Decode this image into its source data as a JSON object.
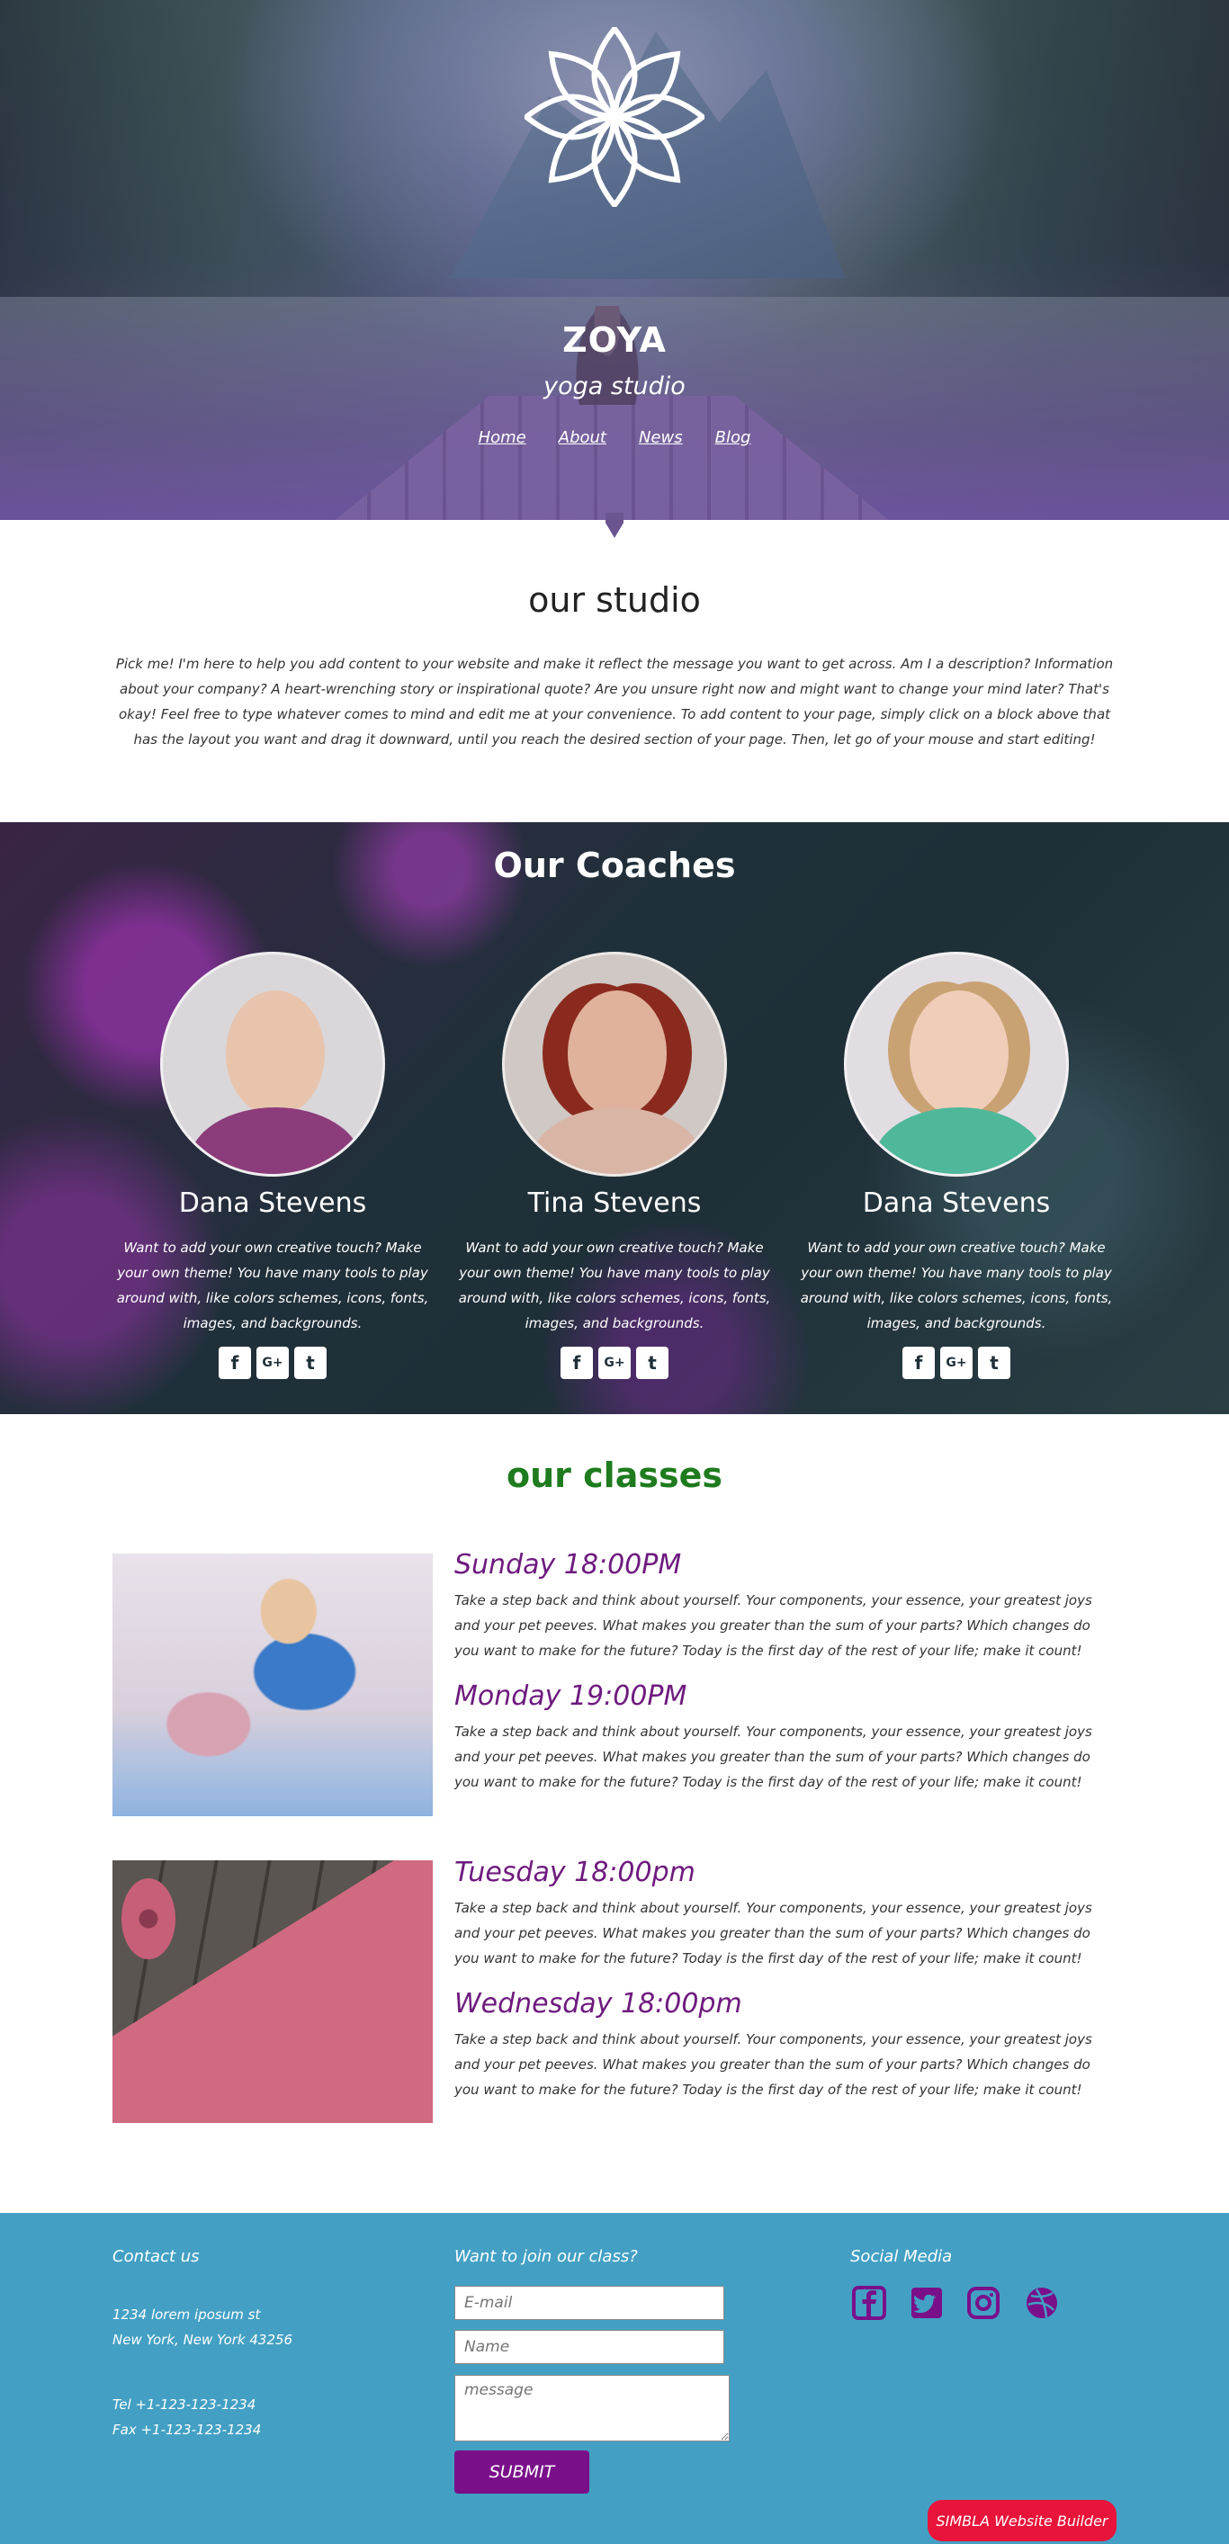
{
  "brand": {
    "title": "ZOYA",
    "subtitle": "yoga studio"
  },
  "nav": [
    {
      "label": "Home"
    },
    {
      "label": "About"
    },
    {
      "label": "News"
    },
    {
      "label": "Blog"
    }
  ],
  "studio": {
    "title": "our studio",
    "text": "Pick me! I'm here to help you add content to your website and make it reflect the message you want to get across. Am I a description? Information about your company? A heart-wrenching story or inspirational quote? Are you unsure right now and might want to change your mind later? That's okay! Feel free to type whatever comes to mind and edit me at your convenience. To add content to your page, simply click on a block above that has the layout you want and drag it downward, until you reach the desired section of your page. Then, let go of your mouse and start editing!"
  },
  "coaches": {
    "title": "Our Coaches",
    "items": [
      {
        "name": "Dana Stevens",
        "bio": "Want to add your own creative touch? Make your own theme! You have many tools to play around with, like colors schemes, icons, fonts, images, and backgrounds."
      },
      {
        "name": "Tina Stevens",
        "bio": "Want to add your own creative touch? Make your own theme! You have many tools to play around with, like colors schemes, icons, fonts, images, and backgrounds."
      },
      {
        "name": "Dana Stevens",
        "bio": "Want to add your own creative touch? Make your own theme! You have many tools to play around with, like colors schemes, icons, fonts, images, and backgrounds."
      }
    ],
    "social_icons": [
      "facebook-icon",
      "google-plus-icon",
      "twitter-icon"
    ]
  },
  "classes": {
    "title": "our classes",
    "items": [
      {
        "time": "Sunday 18:00PM",
        "desc": "Take a step back and think about yourself. Your components, your essence, your greatest joys and your pet peeves. What makes you greater than the sum of your parts? Which changes do you want to make for the future? Today is the first day of the rest of your life; make it count!"
      },
      {
        "time": "Monday 19:00PM",
        "desc": "Take a step back and think about yourself. Your components, your essence, your greatest joys and your pet peeves. What makes you greater than the sum of your parts? Which changes do you want to make for the future? Today is the first day of the rest of your life; make it count!"
      },
      {
        "time": "Tuesday 18:00pm",
        "desc": "Take a step back and think about yourself. Your components, your essence, your greatest joys and your pet peeves. What makes you greater than the sum of your parts? Which changes do you want to make for the future? Today is the first day of the rest of your life; make it count!"
      },
      {
        "time": "Wednesday 18:00pm",
        "desc": "Take a step back and think about yourself. Your components, your essence, your greatest joys and your pet peeves. What makes you greater than the sum of your parts? Which changes do you want to make for the future? Today is the first day of the rest of your life; make it count!"
      }
    ]
  },
  "footer": {
    "contact_title": "Contact us",
    "address_line1": "1234 lorem iposum st",
    "address_line2": "New York, New York 43256",
    "tel": "Tel +1-123-123-1234",
    "fax": "Fax +1-123-123-1234",
    "join_title": "Want to join our class?",
    "email_placeholder": "E-mail",
    "name_placeholder": "Name",
    "message_placeholder": "message",
    "submit_label": "SUBMIT",
    "social_title": "Social Media",
    "social_icons": [
      "facebook-icon",
      "twitter-icon",
      "instagram-icon",
      "dribbble-icon"
    ],
    "badge": "SIMBLA Website Builder"
  },
  "colors": {
    "accent_purple": "#7a0f8a",
    "class_time": "#6e1a7e",
    "classes_title": "#1e7b1e",
    "footer_bg": "#43a0c4",
    "badge_red": "#e8143a"
  }
}
